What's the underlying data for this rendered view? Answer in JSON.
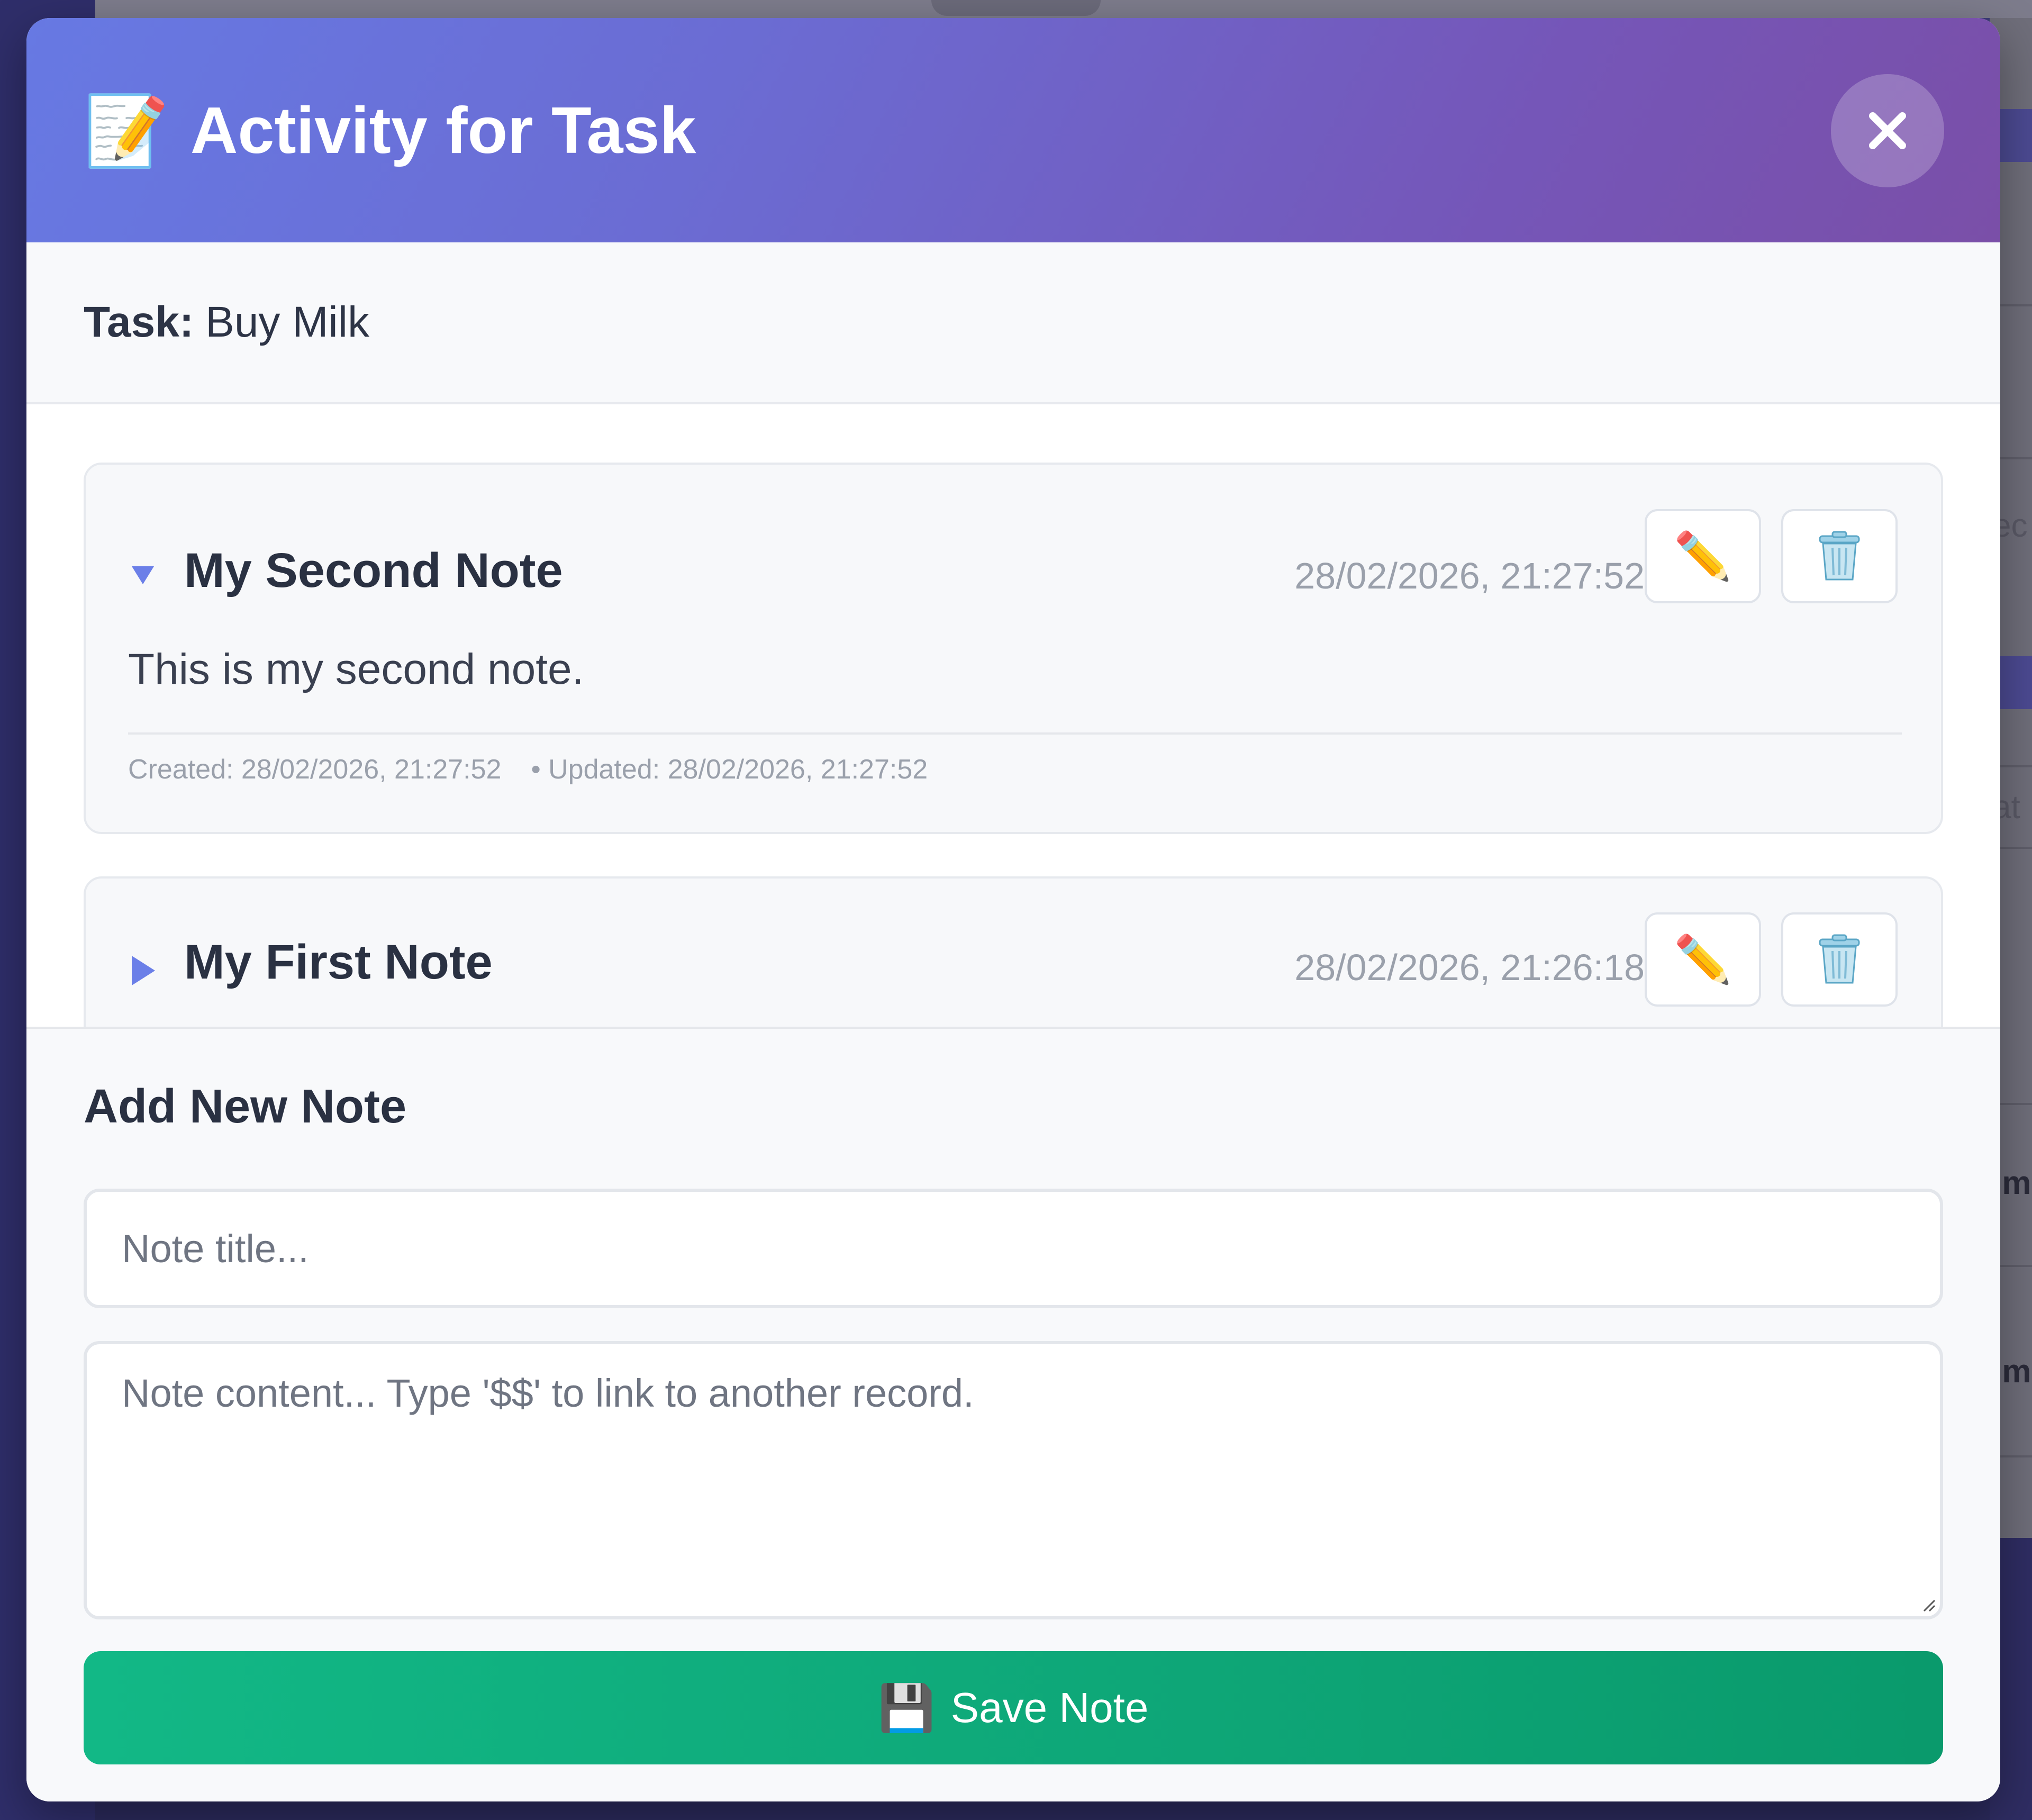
{
  "modal": {
    "title": "Activity for Task",
    "title_icon": "memo-icon",
    "close_icon": "close-icon"
  },
  "task": {
    "label": "Task:",
    "name": "Buy Milk"
  },
  "notes": [
    {
      "title": "My Second Note",
      "timestamp": "28/02/2026, 21:27:52",
      "expanded": true,
      "content": "This is my second note.",
      "created": "Created: 28/02/2026, 21:27:52",
      "updated": "• Updated: 28/02/2026, 21:27:52"
    },
    {
      "title": "My First Note",
      "timestamp": "28/02/2026, 21:26:18",
      "expanded": false
    }
  ],
  "add_note": {
    "heading": "Add New Note",
    "title_placeholder": "Note title...",
    "content_placeholder": "Note content... Type '$$' to link to another record.",
    "save_label": "Save Note",
    "save_icon": "floppy-disk-icon"
  },
  "background_fragments": [
    "ec",
    "at",
    "im",
    "im"
  ],
  "colors": {
    "header_gradient_start": "#6779e3",
    "header_gradient_end": "#7a4fa8",
    "accent_toggle": "#6b7fe8",
    "save_button": "#10b07f"
  }
}
